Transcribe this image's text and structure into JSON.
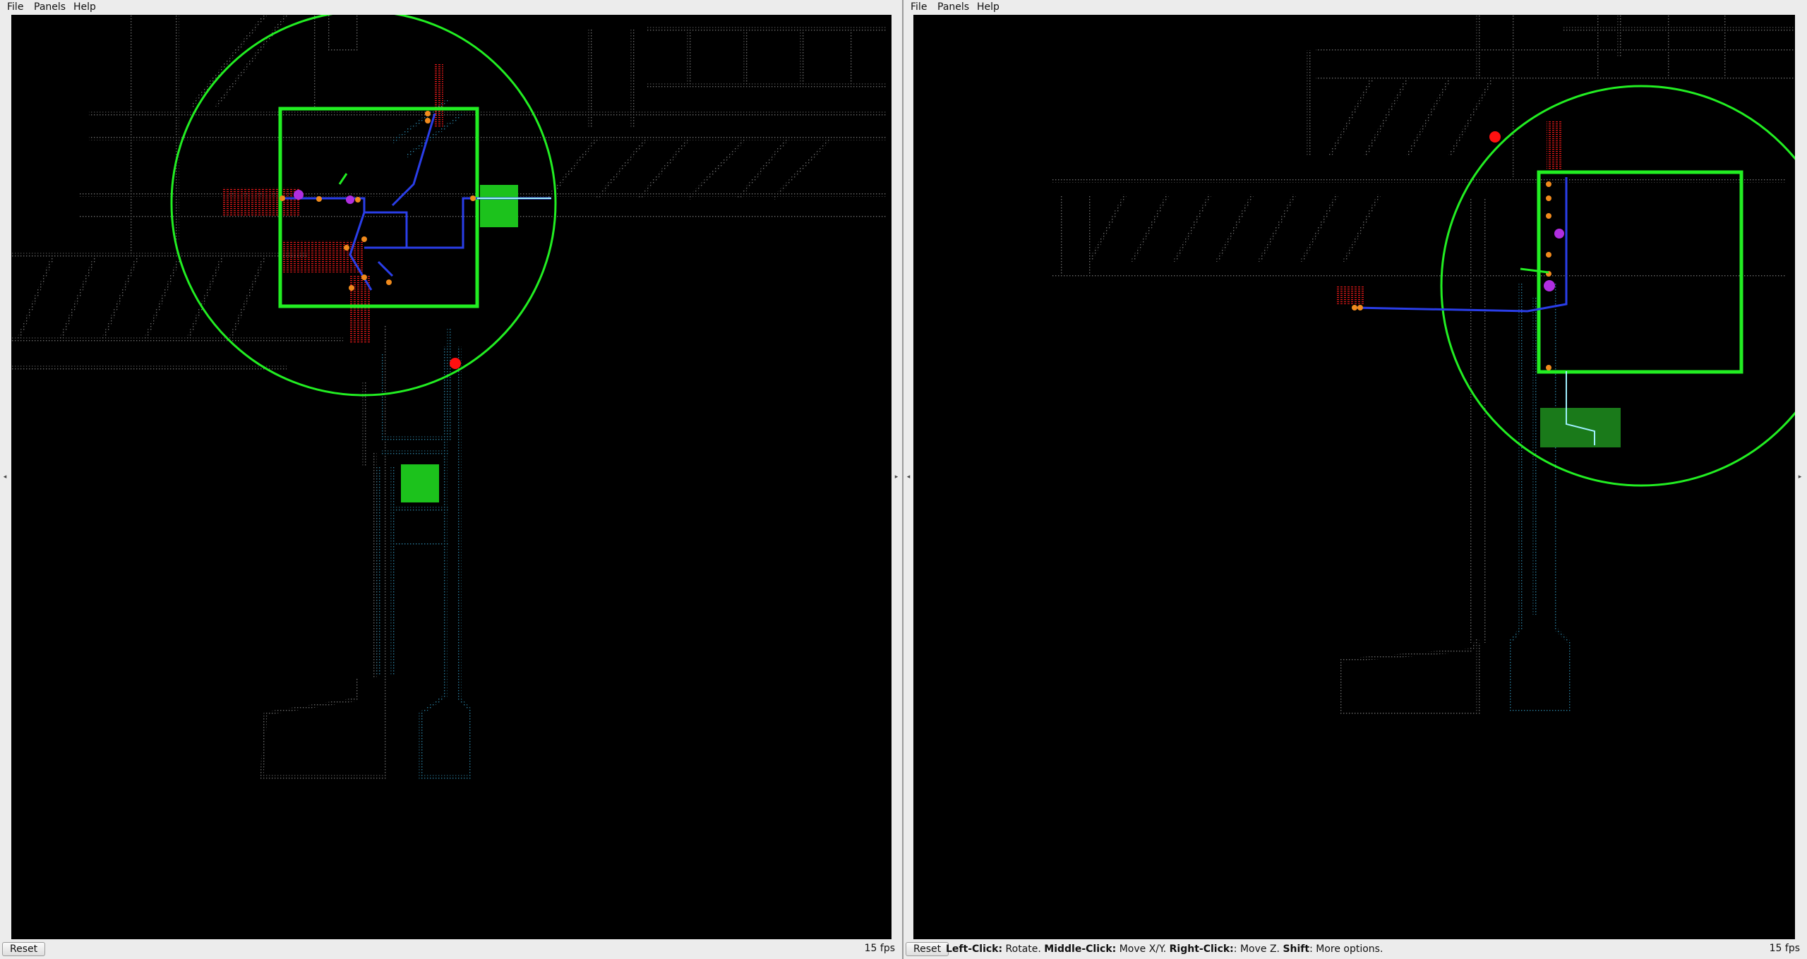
{
  "menus": [
    "File",
    "Panels",
    "Help"
  ],
  "left_window": {
    "reset_label": "Reset",
    "fps": "15 fps"
  },
  "right_window": {
    "reset_label": "Reset",
    "fps": "15 fps",
    "hint": {
      "left_click_key": "Left-Click:",
      "left_click_desc": " Rotate. ",
      "middle_click_key": "Middle-Click:",
      "middle_click_desc": " Move X/Y. ",
      "right_click_key": "Right-Click:",
      "right_click_desc": ": Move Z. ",
      "shift_key": "Shift",
      "shift_desc": ": More options."
    }
  },
  "colors": {
    "map_points": "#6b6b6b",
    "map_points_blue": "#2a7f9f",
    "local_window": "#22ee22",
    "laser_scan": "#e01818",
    "global_path": "#2a3ee8",
    "local_path": "#9ff0ff",
    "waypoint": "#f08a1c",
    "robot_marker": "#b02ee0",
    "goal_marker": "#ff1010",
    "goal_box": "#1cc21c"
  }
}
